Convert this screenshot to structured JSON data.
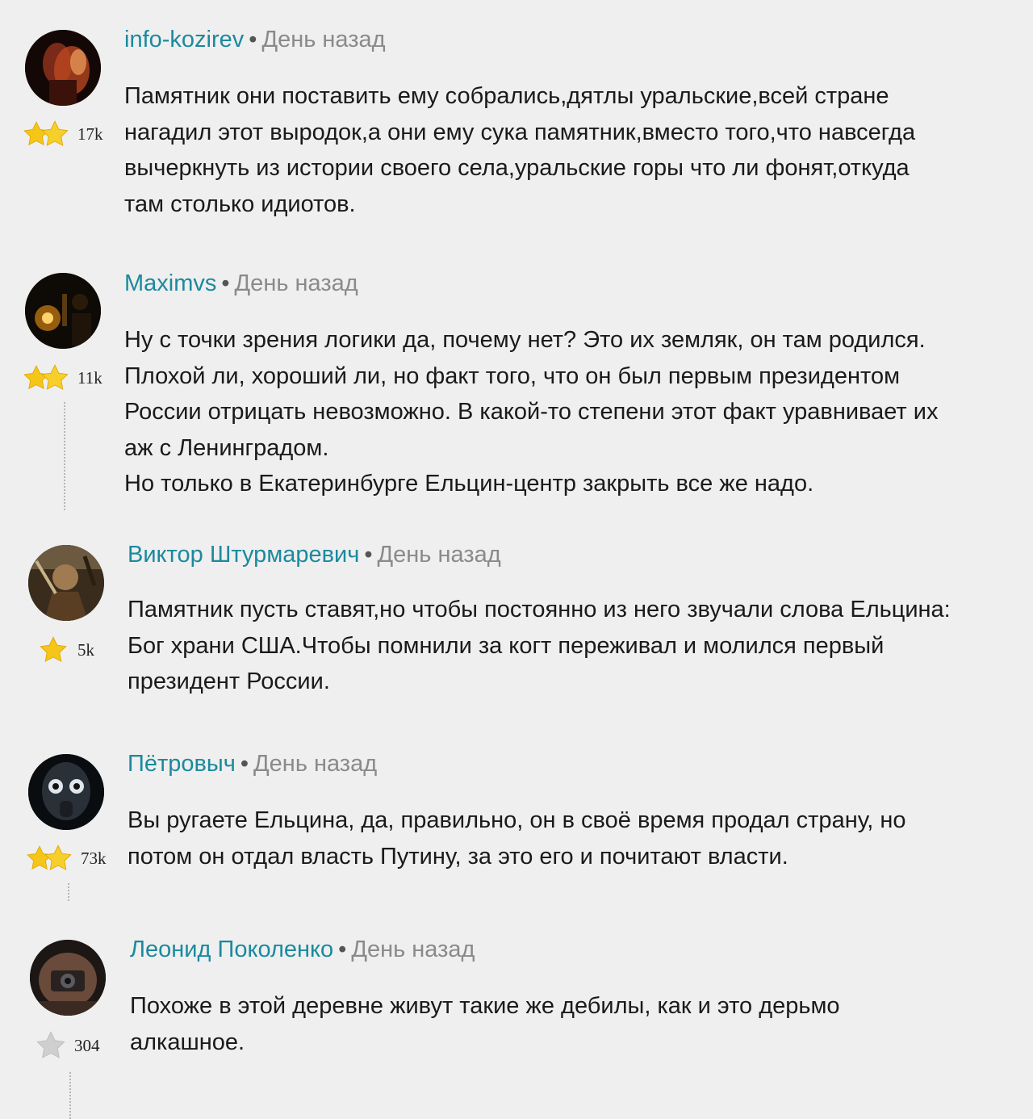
{
  "comments": [
    {
      "author": "info-kozirev",
      "separator": "•",
      "time": "День назад",
      "rating": "17k",
      "text": "Памятник они поставить ему собрались,дятлы уральские,всей стране\nнагадил этот выродок,а они ему сука памятник,вместо того,что навсегда\nвычеркнуть из истории своего села,уральские горы что ли фонят,откуда\nтам столько идиотов.",
      "avatar_icon": "avatar-red-figure",
      "stars_icon": "double-gold-star-icon"
    },
    {
      "author": "Maximvs",
      "separator": "•",
      "time": "День назад",
      "rating": "11k",
      "text": "Ну с точки зрения логики да, почему нет? Это их земляк, он там родился.\nПлохой ли, хороший ли, но факт того, что он был первым президентом\nРоссии отрицать невозможно. В какой-то степени этот факт уравнивает их\nаж с Ленинградом.\nНо только в Екатеринбурге Ельцин-центр закрыть все же надо.",
      "avatar_icon": "avatar-dark-lamp",
      "stars_icon": "double-gold-star-icon"
    },
    {
      "author": "Виктор Штурмаревич",
      "separator": "•",
      "time": "День назад",
      "rating": "5k",
      "text": "Памятник пусть ставят,но чтобы постоянно из него звучали слова Ельцина:\nБог храни США.Чтобы помнили за когт переживал и молился первый\nпрезидент России.",
      "avatar_icon": "avatar-warrior",
      "stars_icon": "single-gold-star-icon"
    },
    {
      "author": "Пётровыч",
      "separator": "•",
      "time": "День назад",
      "rating": "73k",
      "text": "Вы ругаете Ельцина, да, правильно, он в своё время продал страну, но\nпотом он отдал власть Путину, за это его и почитают власти.",
      "avatar_icon": "avatar-gas-mask",
      "stars_icon": "double-gold-star-icon"
    },
    {
      "author": "Леонид Поколенко",
      "separator": "•",
      "time": "День назад",
      "rating": "304",
      "text": "Похоже в этой деревне живут такие же дебилы, как и это дерьмо\nалкашное.",
      "avatar_icon": "avatar-camera",
      "stars_icon": "grey-star-icon"
    }
  ],
  "colors": {
    "background": "#efefef",
    "author": "#1a8a9e",
    "time": "#8a8a8a",
    "text": "#1a1a1a",
    "star_gold": "#f5c518",
    "star_grey": "#c8c8c8"
  }
}
